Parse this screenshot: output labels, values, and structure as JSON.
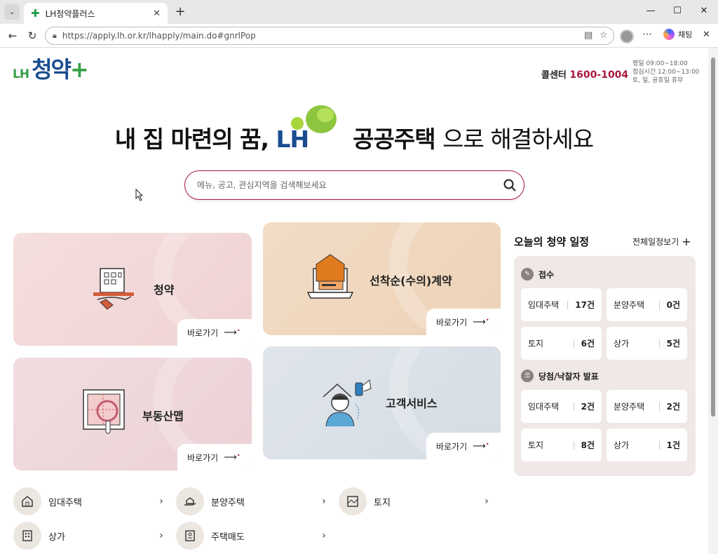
{
  "browser": {
    "tab_title": "LH청약플러스",
    "url": "https://apply.lh.or.kr/lhapply/main.do#gnrlPop",
    "copilot_label": "채팅"
  },
  "header": {
    "logo_lh": "LH",
    "logo_text": "청약",
    "callcenter_label": "콜센터",
    "callcenter_number": "1600-1004",
    "hours_line1": "평일 09:00~18:00",
    "hours_line2": "점심시간 12:00~13:00",
    "hours_line3": "토, 일, 공휴일 휴무"
  },
  "hero": {
    "part1": "내 집 마련의 꿈,",
    "brand": "LH",
    "part2": "공공주택",
    "part3": "으로 해결하세요"
  },
  "search": {
    "placeholder": "메뉴, 공고, 관심지역을 검색해보세요"
  },
  "cards": {
    "apply": "청약",
    "first_come": "선착순(수의)계약",
    "map": "부동산맵",
    "service": "고객서비스",
    "go_label": "바로가기"
  },
  "schedule": {
    "title": "오늘의 청약 일정",
    "view_all": "전체일정보기",
    "receipt": {
      "title": "접수",
      "items": [
        {
          "label": "임대주택",
          "value": "17건"
        },
        {
          "label": "분양주택",
          "value": "0건"
        },
        {
          "label": "토지",
          "value": "6건"
        },
        {
          "label": "상가",
          "value": "5건"
        }
      ]
    },
    "result": {
      "title": "당첨/낙찰자 발표",
      "items": [
        {
          "label": "임대주택",
          "value": "2건"
        },
        {
          "label": "분양주택",
          "value": "2건"
        },
        {
          "label": "토지",
          "value": "8건"
        },
        {
          "label": "상가",
          "value": "1건"
        }
      ]
    }
  },
  "quick_links": [
    {
      "label": "임대주택",
      "icon": "house-icon"
    },
    {
      "label": "분양주택",
      "icon": "hand-house-icon"
    },
    {
      "label": "토지",
      "icon": "land-map-icon"
    },
    {
      "label": "상가",
      "icon": "building-icon"
    },
    {
      "label": "주택매도",
      "icon": "document-icon"
    }
  ]
}
